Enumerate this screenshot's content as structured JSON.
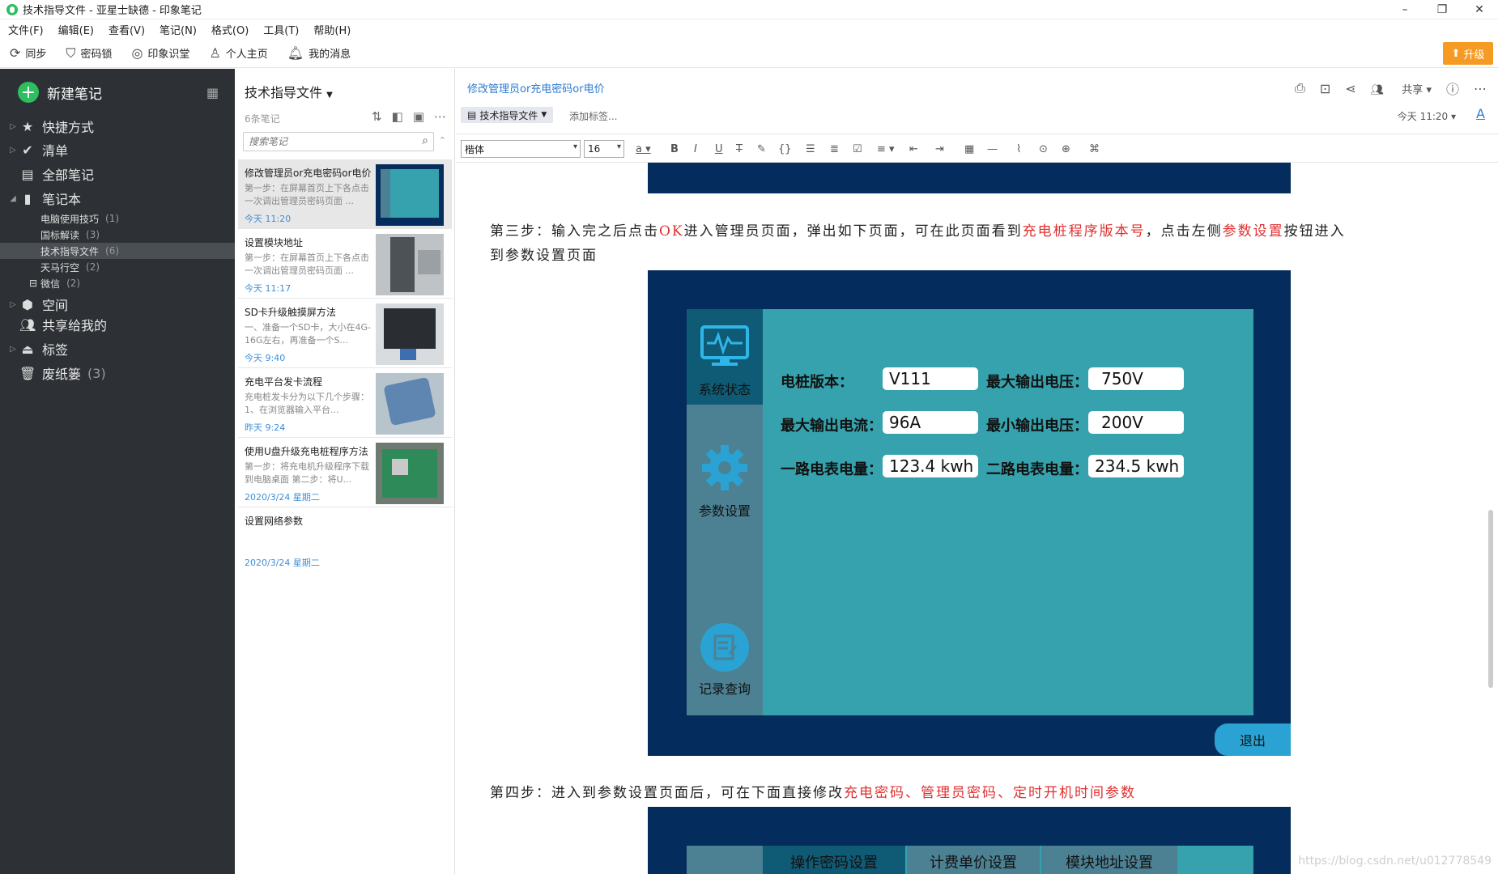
{
  "window": {
    "title": "技术指导文件 - 亚星士缺德 - 印象笔记"
  },
  "menu": [
    "文件(F)",
    "编辑(E)",
    "查看(V)",
    "笔记(N)",
    "格式(O)",
    "工具(T)",
    "帮助(H)"
  ],
  "toolbar": {
    "sync": "同步",
    "lock": "密码锁",
    "knowledge": "印象识堂",
    "profile": "个人主页",
    "messages": "我的消息",
    "upgrade": "升级"
  },
  "sidebar": {
    "new_note": "新建笔记",
    "shortcuts": "快捷方式",
    "checklist": "清单",
    "all_notes": "全部笔记",
    "notebooks": "笔记本",
    "notebook_items": [
      {
        "label": "电脑使用技巧",
        "count": "(1)"
      },
      {
        "label": "国标解读",
        "count": "(3)"
      },
      {
        "label": "技术指导文件",
        "count": "(6)"
      },
      {
        "label": "天马行空",
        "count": "(2)"
      },
      {
        "label": "微信",
        "count": "(2)"
      }
    ],
    "spaces": "空间",
    "shared": "共享给我的",
    "tags": "标签",
    "trash": "废纸篓",
    "trash_count": "(3)"
  },
  "notelist": {
    "title": "技术指导文件",
    "count": "6条笔记",
    "search_placeholder": "搜索笔记",
    "notes": [
      {
        "title": "修改管理员or充电密码or电价",
        "snippet": "第一步：在屏幕首页上下各点击一次调出管理员密码页面 ...",
        "date": "今天 11:20"
      },
      {
        "title": "设置模块地址",
        "snippet": "第一步：在屏幕首页上下各点击一次调出管理员密码页面 ...",
        "date": "今天 11:17"
      },
      {
        "title": "SD卡升级触摸屏方法",
        "snippet": "一、准备一个SD卡，大小在4G-16G左右，再准备一个S...",
        "date": "今天 9:40"
      },
      {
        "title": "充电平台发卡流程",
        "snippet": "充电桩发卡分为以下几个步骤： 1、在浏览器输入平台...",
        "date": "昨天 9:24"
      },
      {
        "title": "使用U盘升级充电桩程序方法",
        "snippet": "第一步：将充电机升级程序下载到电脑桌面 第二步：将U...",
        "date": "2020/3/24 星期二"
      },
      {
        "title": "设置网络参数",
        "snippet": "",
        "date": "2020/3/24 星期二"
      }
    ]
  },
  "editor": {
    "breadcrumb": "修改管理员or充电密码or电价",
    "notebook_chip": "技术指导文件",
    "add_tag": "添加标签...",
    "share": "共享",
    "edit_time": "今天 11:20",
    "font": "楷体",
    "font_size": "16",
    "step3_a": "第三步：输入完之后点击",
    "step3_ok": "OK",
    "step3_b": "进入管理员页面，弹出如下页面，可在此页面看到",
    "step3_red1": "充电桩程序版本号",
    "step3_c": "，点击左侧",
    "step3_red2": "参数设置",
    "step3_d": "按钮进入",
    "step3_line2": "到参数设置页面",
    "step4_a": "第四步：进入到参数设置页面后，可在下面直接修改",
    "step4_red": "充电密码、管理员密码、定时开机时间参数",
    "watermark": "https://blog.csdn.net/u012778549"
  },
  "device": {
    "nav": [
      "系统状态",
      "参数设置",
      "记录查询"
    ],
    "fields": [
      {
        "label": "电桩版本：",
        "value": "V111"
      },
      {
        "label": "最大输出电压：",
        "value": "750V"
      },
      {
        "label": "最大输出电流：",
        "value": "96A"
      },
      {
        "label": "最小输出电压：",
        "value": "200V"
      },
      {
        "label": "一路电表电量：",
        "value": "123.4 kwh"
      },
      {
        "label": "二路电表电量：",
        "value": "234.5 kwh"
      }
    ],
    "exit": "退出",
    "tabs": [
      "操作密码设置",
      "计费单价设置",
      "模块地址设置"
    ]
  }
}
